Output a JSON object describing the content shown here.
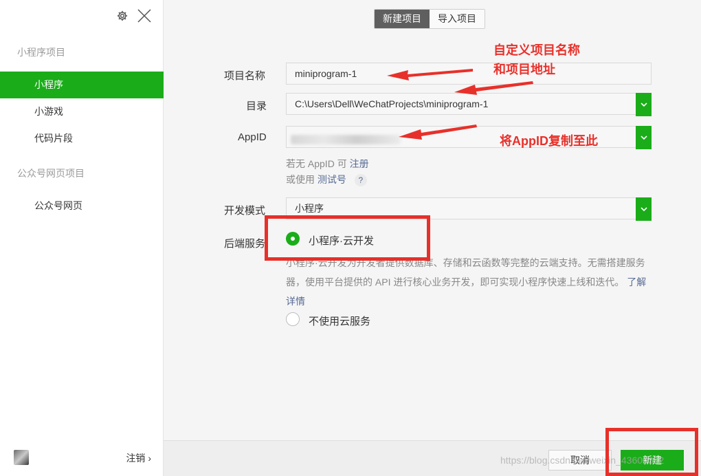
{
  "sidebar": {
    "group1": "小程序项目",
    "items1": [
      {
        "label": "小程序"
      },
      {
        "label": "小游戏"
      },
      {
        "label": "代码片段"
      }
    ],
    "group2": "公众号网页项目",
    "items2": [
      {
        "label": "公众号网页"
      }
    ],
    "logout_label": "注销"
  },
  "tabs": [
    {
      "label": "新建项目"
    },
    {
      "label": "导入项目"
    }
  ],
  "form": {
    "name_label": "项目名称",
    "name_value": "miniprogram-1",
    "dir_label": "目录",
    "dir_value": "C:\\Users\\Dell\\WeChatProjects\\miniprogram-1",
    "appid_label": "AppID",
    "no_appid_prefix": "若无 AppID 可",
    "register_link": "注册",
    "or_use_prefix": "或使用",
    "test_link": "测试号",
    "help_symbol": "?",
    "mode_label": "开发模式",
    "mode_value": "小程序",
    "backend_label": "后端服务",
    "option_cloud": "小程序·云开发",
    "cloud_desc": "小程序·云开发为开发者提供数据库、存储和云函数等完整的云端支持。无需搭建服务器，使用平台提供的 API 进行核心业务开发，即可实现小程序快速上线和迭代。",
    "learn_more": "了解详情",
    "option_no_cloud": "不使用云服务"
  },
  "annotations": {
    "custom_line1": "自定义项目名称",
    "custom_line2": "和项目地址",
    "appid_note": "将AppID复制至此"
  },
  "buttons": {
    "cancel": "取消",
    "create": "新建"
  },
  "watermark": "https://blog.csdn.net/weixin_43600332",
  "colors": {
    "accent": "#1aad19",
    "annotation": "#e8302a",
    "link": "#576b95"
  }
}
